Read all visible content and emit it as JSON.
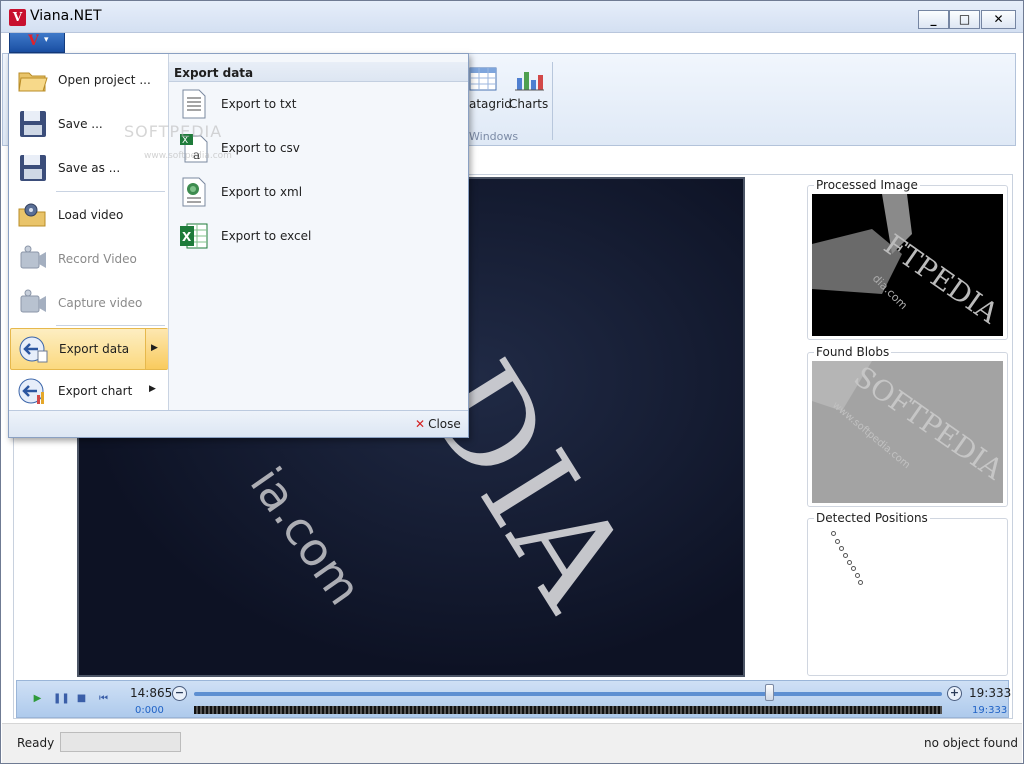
{
  "window": {
    "title": "Viana.NET",
    "controls": {
      "minimize": "_",
      "maximize": "□",
      "close": "✕"
    }
  },
  "app_menu_button": {
    "logo": "V",
    "caret": "▾"
  },
  "ribbon": {
    "buttons": [
      {
        "label": "atagrid",
        "icon": "datagrid-icon"
      },
      {
        "label": "Charts",
        "icon": "bar-chart-icon"
      }
    ],
    "group_label": "Windows"
  },
  "app_menu": {
    "items": [
      {
        "label": "Open project ...",
        "icon": "open-folder-icon",
        "enabled": true
      },
      {
        "label": "Save ...",
        "icon": "floppy-disk-icon",
        "enabled": true
      },
      {
        "label": "Save as ...",
        "icon": "floppy-disk-icon",
        "enabled": true
      },
      {
        "label": "Load video",
        "icon": "film-folder-icon",
        "enabled": true
      },
      {
        "label": "Record Video",
        "icon": "camcorder-icon",
        "enabled": false
      },
      {
        "label": "Capture video",
        "icon": "camcorder-icon",
        "enabled": false
      },
      {
        "label": "Export data",
        "icon": "export-arrow-icon",
        "enabled": true,
        "submenu": true
      },
      {
        "label": "Export chart",
        "icon": "export-chart-icon",
        "enabled": true,
        "submenu": true
      }
    ],
    "submenu": {
      "header": "Export data",
      "items": [
        {
          "label": "Export to txt",
          "icon": "text-file-icon"
        },
        {
          "label": "Export to csv",
          "icon": "csv-file-icon"
        },
        {
          "label": "Export to xml",
          "icon": "xml-file-icon"
        },
        {
          "label": "Export to excel",
          "icon": "excel-file-icon"
        }
      ]
    },
    "close_label": "Close"
  },
  "panels": {
    "processed_image": "Processed Image",
    "found_blobs": "Found Blobs",
    "detected_positions": "Detected Positions"
  },
  "timeline": {
    "current_time": "14:865",
    "start_time": "0:000",
    "end_time": "19:333",
    "end_time_small": "19:333",
    "position_fraction": 0.77
  },
  "statusbar": {
    "status": "Ready",
    "right_text": "no object found"
  },
  "watermark": {
    "text": "SOFTPEDIA",
    "url": "www.softpedia.com"
  }
}
